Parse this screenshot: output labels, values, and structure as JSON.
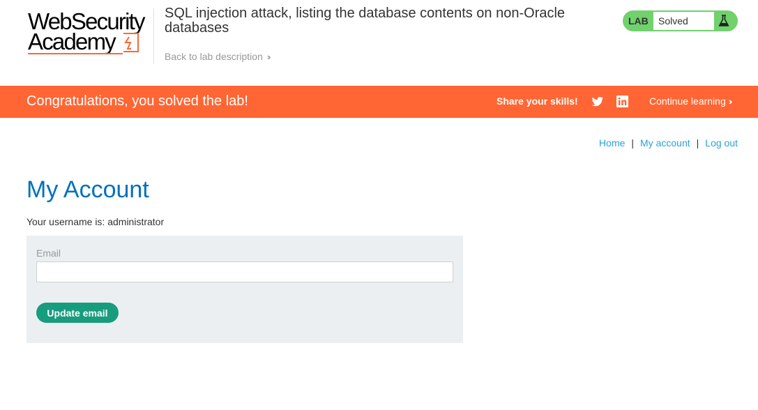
{
  "header": {
    "logo_line1": "WebSecurity",
    "logo_line2": "Academy",
    "lab_title": "SQL injection attack, listing the database contents on non-Oracle databases",
    "back_link": "Back to lab description",
    "lab_badge": "LAB",
    "lab_status": "Solved",
    "accent_color": "#ff6633",
    "badge_color": "#70d16d"
  },
  "banner": {
    "message": "Congratulations, you solved the lab!",
    "share_label": "Share your skills!",
    "continue_label": "Continue learning",
    "icons": [
      "twitter-icon",
      "linkedin-icon"
    ]
  },
  "nav": {
    "home": "Home",
    "my_account": "My account",
    "log_out": "Log out",
    "separator": "|"
  },
  "main": {
    "page_title": "My Account",
    "username_text": "Your username is: administrator",
    "email_label": "Email",
    "email_value": "",
    "update_button": "Update email",
    "title_color": "#0071bc",
    "button_color": "#189c7e"
  }
}
